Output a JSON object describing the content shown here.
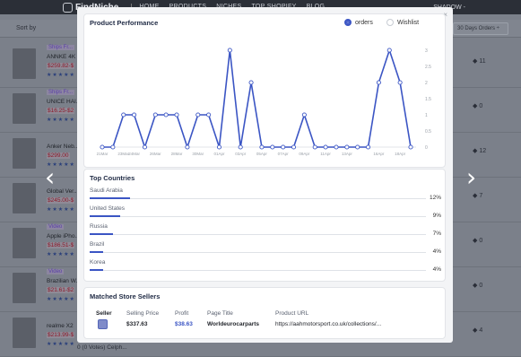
{
  "app": {
    "brand": "FindNiche",
    "nav": [
      "HOME",
      "PRODUCTS",
      "NICHES",
      "TOP SHOPIFY",
      "BLOG"
    ],
    "user": "SHADOW -"
  },
  "filter": {
    "sort_label": "Sort by",
    "period": "30 Days Orders ÷"
  },
  "rows": [
    {
      "tag": "Ships Fr...",
      "name": "ANNKE 4K",
      "price": "$259.82-$",
      "stars": "★★★★★",
      "count": "11"
    },
    {
      "tag": "Ships Fr...",
      "name": "UNICE HAI...",
      "price": "$16.25-$2",
      "stars": "★★★★★",
      "count": "0"
    },
    {
      "tag": "",
      "name": "Anker Neb...",
      "price": "$299.00",
      "stars": "★★★★★",
      "count": "12"
    },
    {
      "tag": "",
      "name": "Global Ver...",
      "price": "$245.00-$",
      "stars": "★★★★★",
      "count": "7"
    },
    {
      "tag": "Video",
      "name": "Apple iPho...",
      "price": "$186.51-$",
      "stars": "★★★★★",
      "count": "0"
    },
    {
      "tag": "Video",
      "name": "Brazilian W...",
      "price": "$21.61-$2",
      "stars": "★★★★★",
      "count": "0"
    },
    {
      "tag": "",
      "name": "realme X2",
      "price": "$213.99-$",
      "stars": "★★★★★",
      "count": "4"
    }
  ],
  "bottom_text": "0 (0 Votes)  Celph...",
  "modal": {
    "close": "×",
    "performance": {
      "title": "Product Performance",
      "legend_orders": "orders",
      "legend_wishlist": "Wishlist"
    },
    "countries": {
      "title": "Top Countries",
      "items": [
        {
          "name": "Saudi Arabia",
          "pct": "12%",
          "value": 12
        },
        {
          "name": "United States",
          "pct": "9%",
          "value": 9
        },
        {
          "name": "Russia",
          "pct": "7%",
          "value": 7
        },
        {
          "name": "Brazil",
          "pct": "4%",
          "value": 4
        },
        {
          "name": "Korea",
          "pct": "4%",
          "value": 4
        }
      ]
    },
    "sellers": {
      "title": "Matched Store Sellers",
      "headers": [
        "Seller",
        "Selling Price",
        "Profit",
        "Page Title",
        "Product URL"
      ],
      "row": {
        "price": "$337.63",
        "profit": "$38.63",
        "page_title": "Worldeurocarparts",
        "url": "https://aahmotorsport.co.uk/collections/..."
      }
    }
  },
  "chart_data": {
    "type": "line",
    "title": "Product Performance",
    "x": [
      "21Mar",
      "22Mar",
      "23Mar",
      "24Mar",
      "25Mar",
      "26Mar",
      "27Mar",
      "28Mar",
      "29Mar",
      "30Mar",
      "31Mar",
      "01Apr",
      "02Apr",
      "03Apr",
      "04Apr",
      "05Apr",
      "06Apr",
      "07Apr",
      "08Apr",
      "09Apr",
      "10Apr",
      "11Apr",
      "12Apr",
      "13Apr",
      "14Apr",
      "15Apr",
      "16Apr",
      "17Apr",
      "18Apr",
      "19Apr"
    ],
    "x_tick_labels": [
      "21Mar",
      "23Mar",
      "24Mar",
      "26Mar",
      "28Mar",
      "30Mar",
      "01Apr",
      "03Apr",
      "05Apr",
      "07Apr",
      "09Apr",
      "11Apr",
      "13Apr",
      "16Apr",
      "18Apr"
    ],
    "series": [
      {
        "name": "orders",
        "values": [
          0,
          0,
          1,
          1,
          0,
          1,
          1,
          1,
          0,
          1,
          1,
          0,
          3,
          0,
          2,
          0,
          0,
          0,
          0,
          1,
          0,
          0,
          0,
          0,
          0,
          0,
          2,
          3,
          2,
          0
        ]
      }
    ],
    "y_ticks": [
      "0",
      "0.5",
      "1",
      "1.5",
      "2",
      "2.5",
      "3"
    ],
    "ylim": [
      0,
      3
    ],
    "grid": false,
    "colors": {
      "orders": "#3b55c4"
    }
  }
}
